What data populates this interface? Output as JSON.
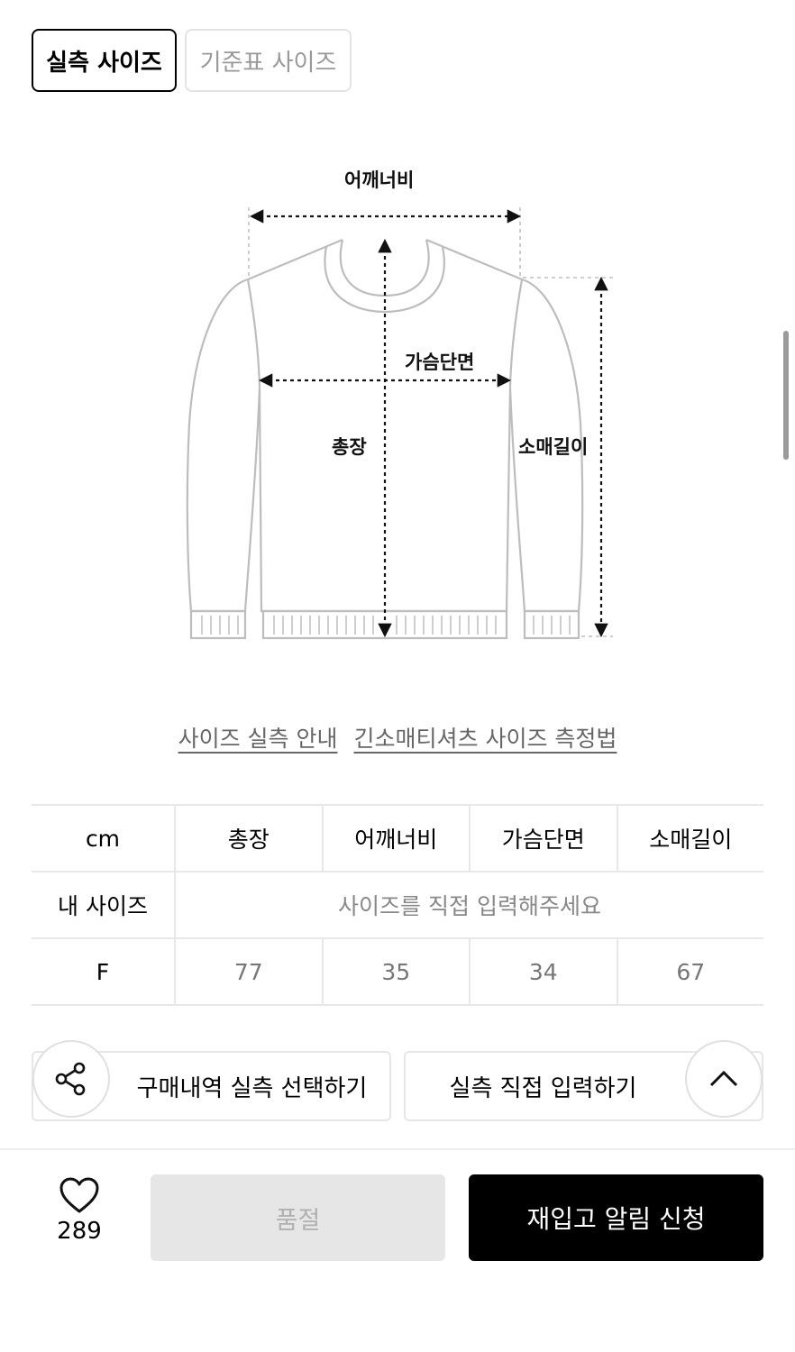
{
  "tabs": {
    "actual_size": "실측 사이즈",
    "standard_size": "기준표 사이즈"
  },
  "diagram": {
    "shoulder_width": "어깨너비",
    "chest_width": "가슴단면",
    "total_length": "총장",
    "sleeve_length": "소매길이"
  },
  "guide_links": {
    "measure_guide": "사이즈 실측 안내",
    "method": "긴소매티셔츠 사이즈 측정법"
  },
  "table": {
    "unit": "cm",
    "headers": [
      "총장",
      "어깨너비",
      "가슴단면",
      "소매길이"
    ],
    "my_size_label": "내 사이즈",
    "my_size_prompt": "사이즈를 직접 입력해주세요",
    "rows": [
      {
        "size": "F",
        "values": [
          "77",
          "35",
          "34",
          "67"
        ]
      }
    ]
  },
  "actions": {
    "purchase_history": "구매내역 실측 선택하기",
    "manual_input": "실측 직접 입력하기"
  },
  "footer": {
    "like_count": "289",
    "sold_out": "품절",
    "restock_alert": "재입고 알림 신청"
  }
}
